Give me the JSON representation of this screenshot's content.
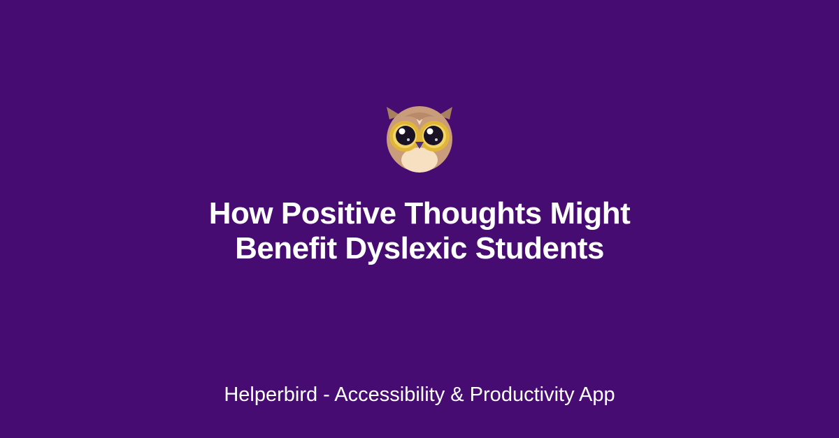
{
  "page": {
    "background_color": "#470c72",
    "text_color": "#ffffff"
  },
  "logo": {
    "icon": "owl-mascot-icon",
    "colors": {
      "face": "#c99c7b",
      "belly": "#f7dfc2",
      "eye_ring": "#e1b537",
      "pupil": "#1a1326",
      "beak": "#4a2e7d"
    }
  },
  "headline": {
    "line1": "How Positive Thoughts Might",
    "line2": "Benefit Dyslexic Students"
  },
  "footer": {
    "text": "Helperbird - Accessibility & Productivity App"
  }
}
